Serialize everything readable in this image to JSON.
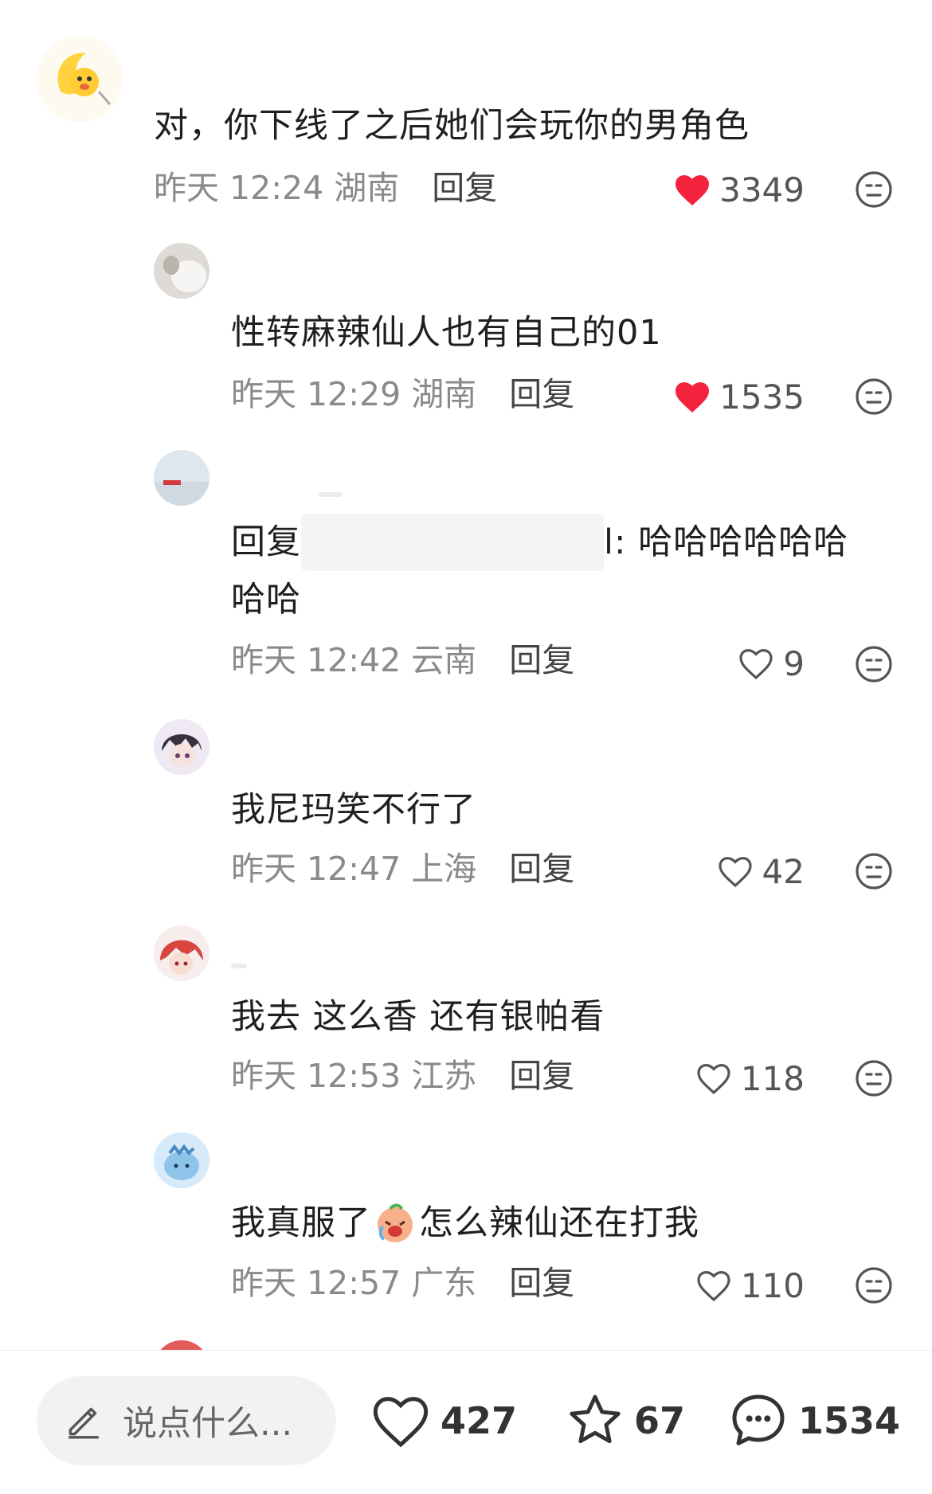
{
  "comments": [
    {
      "text": "对，你下线了之后她们会玩你的男角色",
      "time": "昨天 12:24",
      "location": "湖南",
      "reply_label": "回复",
      "likes": "3349",
      "liked": true
    },
    {
      "text": "性转麻辣仙人也有自己的01",
      "time": "昨天 12:29",
      "location": "湖南",
      "reply_label": "回复",
      "likes": "1535",
      "liked": true
    },
    {
      "reply_prefix": "回复",
      "text_tail": "l: 哈哈哈哈哈哈",
      "text_line2": "哈哈",
      "time": "昨天 12:42",
      "location": "云南",
      "reply_label": "回复",
      "likes": "9",
      "liked": false
    },
    {
      "text": "我尼玛笑不行了",
      "time": "昨天 12:47",
      "location": "上海",
      "reply_label": "回复",
      "likes": "42",
      "liked": false
    },
    {
      "text": "我去 这么香 还有银帕看",
      "time": "昨天 12:53",
      "location": "江苏",
      "reply_label": "回复",
      "likes": "118",
      "liked": false
    },
    {
      "text_before": "我真服了",
      "text_after": "怎么辣仙还在打我",
      "time": "昨天 12:57",
      "location": "广东",
      "reply_label": "回复",
      "likes": "110",
      "liked": false
    }
  ],
  "bottom_bar": {
    "placeholder": "说点什么...",
    "likes": "427",
    "favorites": "67",
    "comments": "1534"
  },
  "colors": {
    "liked_heart": "#f5223d",
    "meta_gray": "#8a8a8a"
  }
}
